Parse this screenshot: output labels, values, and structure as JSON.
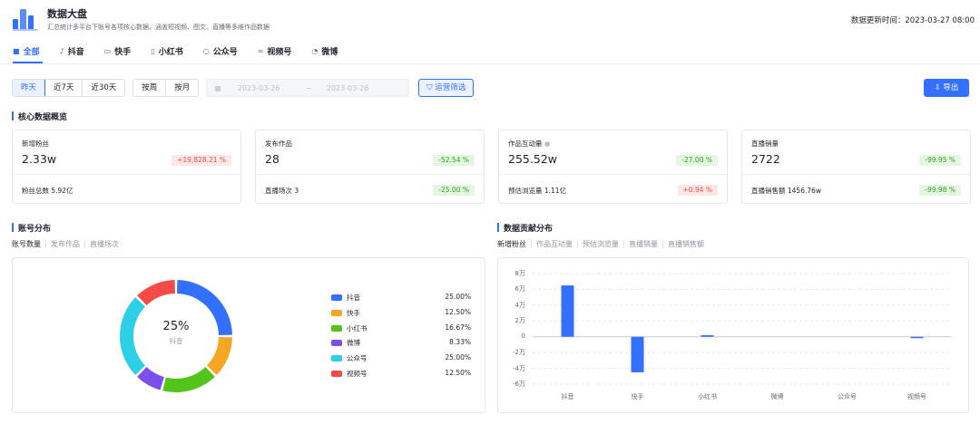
{
  "header": {
    "title": "数据大盘",
    "subtitle": "汇总统计多平台下账号各项核心数据，涵盖短视频、图文、直播等多维作品数据",
    "update_label": "数据更新时间：",
    "update_time": "2023-03-27 08:00"
  },
  "tabs": [
    {
      "label": "全部",
      "icon": "grid-icon",
      "glyph": "■",
      "active": true
    },
    {
      "label": "抖音",
      "icon": "douyin-icon",
      "glyph": "♪"
    },
    {
      "label": "快手",
      "icon": "kuaishou-icon",
      "glyph": "▭"
    },
    {
      "label": "小红书",
      "icon": "xiaohongshu-icon",
      "glyph": "▯"
    },
    {
      "label": "公众号",
      "icon": "wechat-official-icon",
      "glyph": "○"
    },
    {
      "label": "视频号",
      "icon": "channels-icon",
      "glyph": "∞"
    },
    {
      "label": "微博",
      "icon": "weibo-icon",
      "glyph": "◔"
    }
  ],
  "filters": {
    "range": [
      "昨天",
      "近7天",
      "近30天"
    ],
    "range_selected": "昨天",
    "granularity": [
      "按周",
      "按月"
    ],
    "date_start": "2023-03-26",
    "date_sep": "~",
    "date_end": "2023-03-26",
    "ops_filter": "运营筛选",
    "export": "导出"
  },
  "overview": {
    "title": "核心数据概览",
    "cards": [
      {
        "label": "新增粉丝",
        "value": "2.33w",
        "badge": "+19,828.21 %",
        "badge_dir": "up",
        "sub": "粉丝总数 5.92亿",
        "sub_badge": ""
      },
      {
        "label": "发布作品",
        "value": "28",
        "badge": "-52.54 %",
        "badge_dir": "down",
        "sub": "直播场次 3",
        "sub_badge": "-25.00 %",
        "sub_badge_dir": "down"
      },
      {
        "label": "作品互动量",
        "value": "255.52w",
        "badge": "-27.00 %",
        "badge_dir": "down",
        "sub": "预估浏览量 1.11亿",
        "sub_badge": "+0.94 %",
        "sub_badge_dir": "up"
      },
      {
        "label": "直播销量",
        "value": "2722",
        "badge": "-99.95 %",
        "badge_dir": "down",
        "sub": "直播销售额 1456.76w",
        "sub_badge": "-99.98 %",
        "sub_badge_dir": "down"
      }
    ]
  },
  "account_dist": {
    "title": "账号分布",
    "subtabs": [
      "账号数量",
      "发布作品",
      "直播场次"
    ],
    "center_pct": "25%",
    "center_name": "抖音"
  },
  "contribution": {
    "title": "数据贡献分布",
    "subtabs": [
      "新增粉丝",
      "作品互动量",
      "预估浏览量",
      "直播销量",
      "直播销售额"
    ]
  },
  "chart_data": [
    {
      "type": "pie",
      "style": "donut",
      "categories": [
        "抖音",
        "快手",
        "小红书",
        "微博",
        "公众号",
        "视频号"
      ],
      "values": [
        25.0,
        12.5,
        16.67,
        8.33,
        25.0,
        12.5
      ],
      "labels": [
        "25.00%",
        "12.50%",
        "16.67%",
        "8.33%",
        "25.00%",
        "12.50%"
      ],
      "colors": [
        "#3370ff",
        "#f5a623",
        "#52c41a",
        "#7b4fe9",
        "#2ed0e8",
        "#f54a45"
      ],
      "legend": "right"
    },
    {
      "type": "bar",
      "categories": [
        "抖音",
        "快手",
        "小红书",
        "微博",
        "公众号",
        "视频号"
      ],
      "values": [
        65000,
        -45000,
        2000,
        0,
        0,
        -500
      ],
      "ylim": [
        -60000,
        80000
      ],
      "ytick_labels": [
        "8万",
        "6万",
        "4万",
        "2万",
        "0",
        "-2万",
        "-4万",
        "-6万"
      ],
      "ytick_values": [
        80000,
        60000,
        40000,
        20000,
        0,
        -20000,
        -40000,
        -60000
      ],
      "color": "#3370ff",
      "grid": true
    }
  ]
}
